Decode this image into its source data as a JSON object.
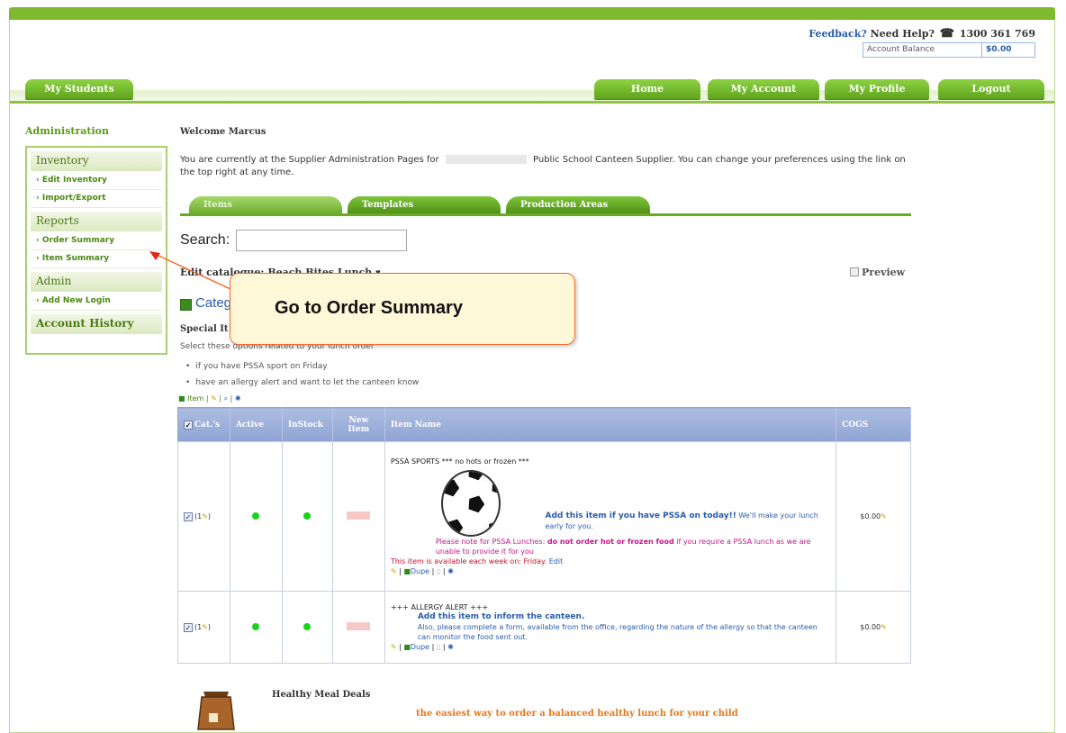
{
  "header": {
    "feedback": "Feedback?",
    "help": "Need Help?",
    "phone": "1300 361 769",
    "balance_label": "Account Balance",
    "balance_value": "$0.00"
  },
  "nav": {
    "my_students": "My Students",
    "home": "Home",
    "my_account": "My Account",
    "my_profile": "My Profile",
    "logout": "Logout"
  },
  "sidebar": {
    "title": "Administration",
    "sections": [
      {
        "label": "Inventory",
        "links": [
          "› Edit Inventory",
          "› Import/Export"
        ]
      },
      {
        "label": "Reports",
        "links": [
          "› Order Summary",
          "› Item Summary"
        ]
      },
      {
        "label": "Admin",
        "links": [
          "› Add New Login"
        ]
      },
      {
        "label": "Account History",
        "links": []
      }
    ]
  },
  "main": {
    "welcome": "Welcome Marcus",
    "intro_a": "You are currently at the Supplier Administration Pages for",
    "intro_b": "Public School Canteen Supplier. You can change your preferences using the link on the top right at any time.",
    "tabs": [
      "Items",
      "Templates",
      "Production Areas"
    ],
    "search_label": "Search:",
    "edit_catalogue": "Edit catalogue:",
    "catalogue_value": "Beach Bites Lunch",
    "preview": "Preview",
    "category_title": "Categ",
    "special_heading": "Special It",
    "select_text": "Select these options related to your lunch order",
    "bullets": [
      "if you have PSSA sport on Friday",
      "have an allergy alert and want to let the canteen know"
    ],
    "mini_toolbar": "Item |",
    "table": {
      "headers": [
        "Cat.'s",
        "Active",
        "InStock",
        "New Item",
        "Item Name",
        "COGS"
      ],
      "rows": [
        {
          "cat": "(1",
          "title": "PSSA SPORTS *** no hots or frozen ***",
          "add": "Add this item if you have PSSA on today!!",
          "early": "We'll make your lunch early for you.",
          "note_a": "Please note for PSSA Lunches:",
          "note_b": "do not order hot or frozen food",
          "note_c": "if you require a PSSA lunch as we are unable to provide it for you",
          "avail": "This item is available each week on: Friday.",
          "edit": "Edit",
          "dupe": "Dupe",
          "cogs": "$0.00"
        },
        {
          "cat": "(1",
          "title": "+++ ALLERGY ALERT +++",
          "add": "Add this item to inform the canteen.",
          "desc": "Also, please complete a form, available from the office, regarding the nature of the allergy so that the canteen can monitor the food sent out.",
          "dupe": "Dupe",
          "cogs": "$0.00"
        }
      ]
    },
    "meal_title": "Healthy Meal Deals",
    "meal_sub": "the easiest way to order a balanced healthy lunch for your child"
  },
  "tooltip": "Go to Order Summary",
  "colors": {
    "accent_green": "#7dba2e",
    "link_blue": "#2a5caa",
    "tooltip_border": "#f26b2d"
  }
}
